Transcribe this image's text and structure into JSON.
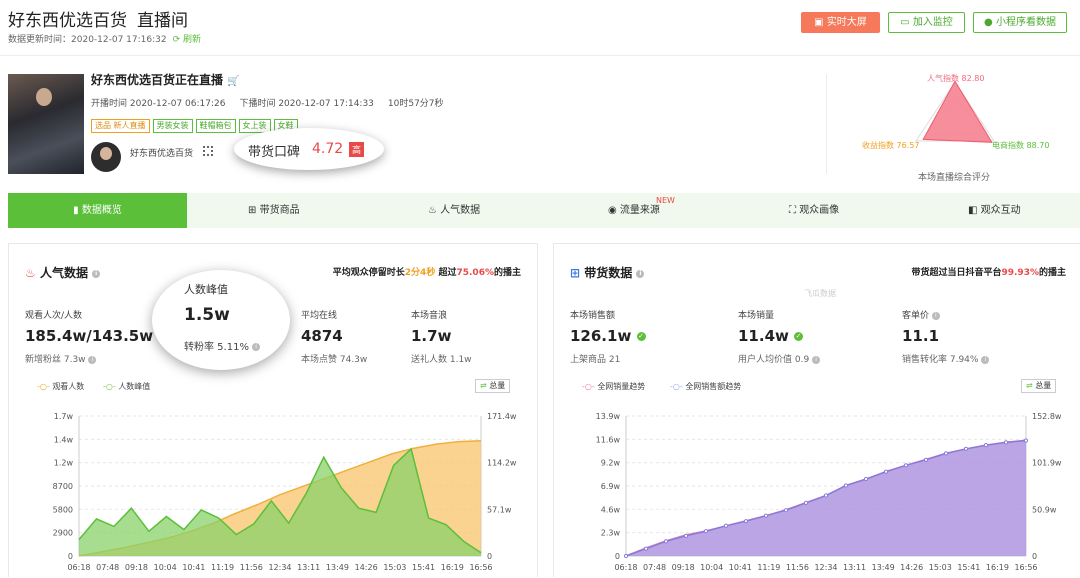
{
  "header": {
    "title": "好东西优选百货",
    "subtitle": "直播间",
    "update_label": "数据更新时间：",
    "update_time": "2020-12-07 17:16:32",
    "refresh": "刷新",
    "buttons": {
      "realtime": "实时大屏",
      "monitor": "加入监控",
      "miniprogram": "小程序看数据"
    }
  },
  "live": {
    "title": "好东西优选百货正在直播",
    "start": "开播时间 2020-12-07 06:17:26",
    "end": "下播时间 2020-12-07 17:14:33",
    "duration": "10时57分7秒",
    "tags": [
      "选品",
      "新人直播",
      "男装女装",
      "鞋帽箱包",
      "女上装",
      "女鞋"
    ],
    "anchor": "好东西优选百货",
    "reputation_label": "带货口碑",
    "reputation_value": "4.72",
    "reputation_badge": "高"
  },
  "radar": {
    "popularity": "人气指数 82.80",
    "revenue": "收益指数 76.57",
    "ecommerce": "电商指数 88.70",
    "caption": "本场直播综合评分",
    "values": {
      "popularity": 82.8,
      "revenue": 76.57,
      "ecommerce": 88.7
    }
  },
  "tabs": [
    "数据概览",
    "带货商品",
    "人气数据",
    "流量来源",
    "观众画像",
    "观众互动"
  ],
  "tab_new": "NEW",
  "popularity": {
    "title": "人气数据",
    "note_pre": "平均观众停留时长",
    "note_stay": "2分4秒",
    "note_mid": "超过",
    "note_pct": "75.06%",
    "note_post": "的播主",
    "m1_label": "观看人次/人数",
    "m1_value": "185.4w/143.5w",
    "m1_sub": "新增粉丝 7.3w",
    "m3_label": "平均在线",
    "m3_value": "4874",
    "m3_sub": "本场点赞 74.3w",
    "m4_label": "本场音浪",
    "m4_value": "1.7w",
    "m4_sub": "送礼人数 1.1w",
    "peak_label": "人数峰值",
    "peak_value": "1.5w",
    "peak_sub": "转粉率 5.11%",
    "legend1": "观看人数",
    "legend2": "人数峰值",
    "total": "总量"
  },
  "sales": {
    "title": "带货数据",
    "note_pre": "带货超过当日抖音平台",
    "note_pct": "99.93%",
    "note_post": "的播主",
    "m1_label": "本场销售额",
    "m1_value": "126.1w",
    "m1_sub": "上架商品 21",
    "m2_label": "本场销量",
    "m2_value": "11.4w",
    "m2_sub": "用户人均价值 0.9",
    "m3_label": "客单价",
    "m3_value": "11.1",
    "m3_sub": "销售转化率 7.94%",
    "legend1": "全网销量趋势",
    "legend2": "全网销售额趋势",
    "total": "总量",
    "watermark": "飞瓜数据"
  },
  "chart_data": [
    {
      "type": "area",
      "title": "人气数据",
      "x": [
        "06:18",
        "07:48",
        "09:18",
        "10:04",
        "10:41",
        "11:19",
        "11:56",
        "12:34",
        "13:11",
        "13:49",
        "14:26",
        "15:03",
        "15:41",
        "16:19",
        "16:56"
      ],
      "yleft_ticks": [
        "0",
        "2900",
        "5800",
        "8700",
        "1.2w",
        "1.4w",
        "1.7w"
      ],
      "yright_ticks": [
        "0",
        "57.1w",
        "114.2w",
        "171.4w"
      ],
      "ylim_left": [
        0,
        17000
      ],
      "ylim_right": [
        0,
        171.4
      ],
      "series": [
        {
          "name": "观看人数",
          "axis": "right",
          "values": [
            0,
            5,
            10,
            16,
            22,
            30,
            40,
            52,
            63,
            75,
            85,
            95,
            105,
            115,
            125,
            132,
            137,
            140,
            141
          ]
        },
        {
          "name": "人数峰值",
          "axis": "left",
          "values": [
            2000,
            4500,
            3600,
            5800,
            3000,
            4800,
            3200,
            5600,
            4600,
            2600,
            3900,
            6700,
            4000,
            7600,
            12000,
            8300,
            5800,
            5300,
            11000,
            13000,
            4600,
            3800,
            1800,
            400
          ]
        }
      ]
    },
    {
      "type": "area",
      "title": "带货数据",
      "x": [
        "06:18",
        "07:48",
        "09:18",
        "10:04",
        "10:41",
        "11:19",
        "11:56",
        "12:34",
        "13:11",
        "13:49",
        "14:26",
        "15:03",
        "15:41",
        "16:19",
        "16:56"
      ],
      "yleft_ticks": [
        "0",
        "2.3w",
        "4.6w",
        "6.9w",
        "9.2w",
        "11.6w",
        "13.9w"
      ],
      "yright_ticks": [
        "0",
        "50.9w",
        "101.9w",
        "152.8w"
      ],
      "ylim_left": [
        0,
        13.9
      ],
      "ylim_right": [
        0,
        152.8
      ],
      "series": [
        {
          "name": "全网销量趋势",
          "axis": "left",
          "values": [
            0,
            0.8,
            1.5,
            2.1,
            2.5,
            3.0,
            3.5,
            4.0,
            4.6,
            5.3,
            6.0,
            7.0,
            7.6,
            8.4,
            9.0,
            9.6,
            10.2,
            10.6,
            11.0,
            11.3,
            11.5
          ]
        },
        {
          "name": "全网销售额趋势",
          "axis": "right",
          "values": [
            0,
            8,
            16,
            22,
            27,
            33,
            38,
            44,
            50,
            58,
            66,
            77,
            84,
            92,
            99,
            105,
            112,
            117,
            121,
            124,
            126
          ]
        }
      ]
    }
  ]
}
